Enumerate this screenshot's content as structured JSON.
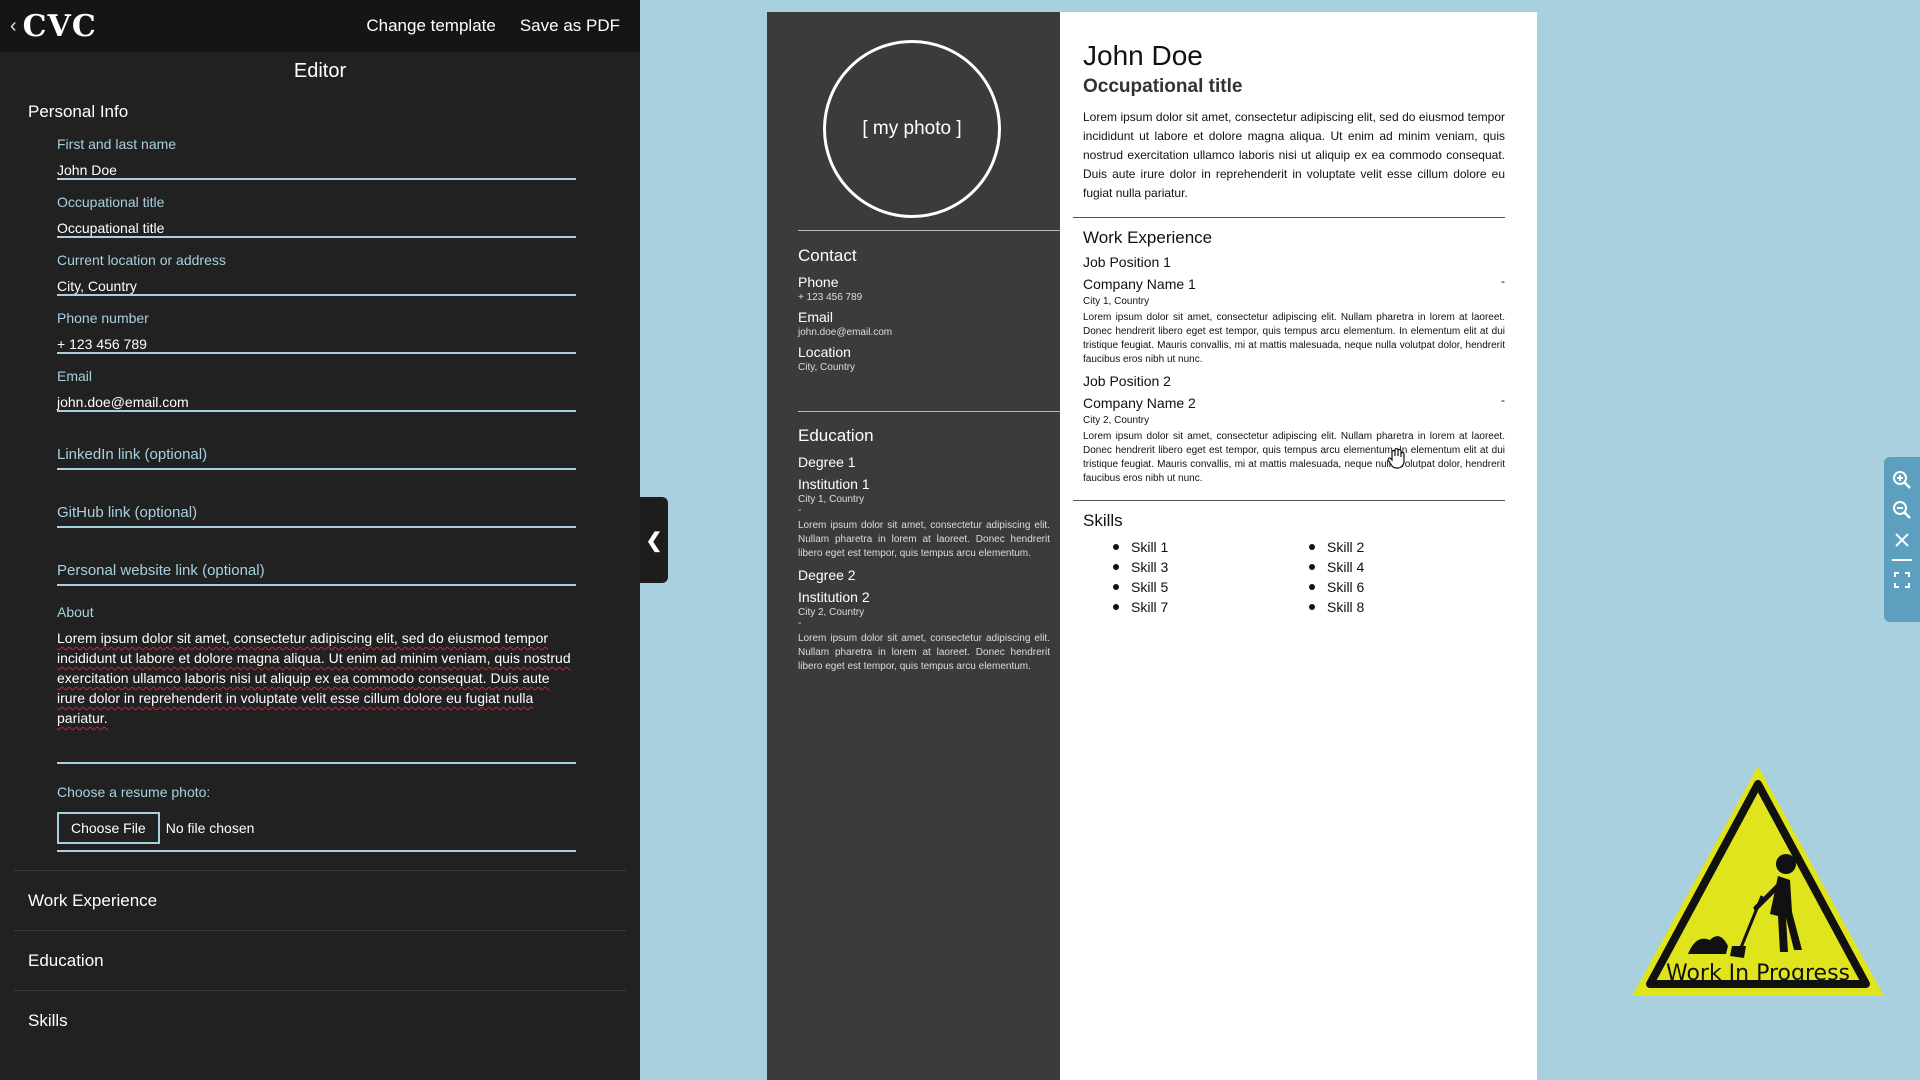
{
  "app": {
    "logo": "CVC",
    "back_icon": "chevron-left-icon",
    "change_template": "Change template",
    "save_pdf": "Save as PDF"
  },
  "editor": {
    "title": "Editor",
    "personal_info": "Personal Info",
    "fields": {
      "name_label": "First and last name",
      "name_value": "John Doe",
      "occ_label": "Occupational title",
      "occ_value": "Occupational title",
      "location_label": "Current location or address",
      "location_value": "City, Country",
      "phone_label": "Phone number",
      "phone_value": "+ 123 456 789",
      "email_label": "Email",
      "email_value": "john.doe@email.com",
      "linkedin_placeholder": "LinkedIn link (optional)",
      "github_placeholder": "GitHub link (optional)",
      "website_placeholder": "Personal website link (optional)",
      "about_label": "About",
      "about_value": "Lorem ipsum dolor sit amet, consectetur adipiscing elit, sed do eiusmod tempor incididunt ut labore et dolore magna aliqua. Ut enim ad minim veniam, quis nostrud exercitation ullamco laboris nisi ut aliquip ex ea commodo consequat. Duis aute irure dolor in reprehenderit in voluptate velit esse cillum dolore eu fugiat nulla pariatur.",
      "photo_label": "Choose a resume photo:",
      "file_button": "Choose File",
      "file_status": "No file chosen"
    },
    "sections": [
      "Work Experience",
      "Education",
      "Skills"
    ]
  },
  "resume": {
    "photo_placeholder": "[ my photo ]",
    "contact": {
      "heading": "Contact",
      "phone_label": "Phone",
      "phone": "+ 123 456 789",
      "email_label": "Email",
      "email": "john.doe@email.com",
      "location_label": "Location",
      "location": "City, Country"
    },
    "education": {
      "heading": "Education",
      "items": [
        {
          "degree": "Degree 1",
          "institution": "Institution 1",
          "city": "City 1, Country",
          "dash": "-",
          "desc": "Lorem ipsum dolor sit amet, consectetur adipiscing elit. Nullam pharetra in lorem at laoreet. Donec hendrerit libero eget est tempor, quis tempus arcu elementum."
        },
        {
          "degree": "Degree 2",
          "institution": "Institution 2",
          "city": "City 2, Country",
          "dash": "-",
          "desc": "Lorem ipsum dolor sit amet, consectetur adipiscing elit. Nullam pharetra in lorem at laoreet. Donec hendrerit libero eget est tempor, quis tempus arcu elementum."
        }
      ]
    },
    "name": "John Doe",
    "occupation": "Occupational title",
    "about": "Lorem ipsum dolor sit amet, consectetur adipiscing elit, sed do eiusmod tempor incididunt ut labore et dolore magna aliqua. Ut enim ad minim veniam, quis nostrud exercitation ullamco laboris nisi ut aliquip ex ea commodo consequat. Duis aute irure dolor in reprehenderit in voluptate velit esse cillum dolore eu fugiat nulla pariatur.",
    "work": {
      "heading": "Work Experience",
      "items": [
        {
          "title": "Job Position 1",
          "company": "Company Name 1",
          "dash": "-",
          "city": "City 1, Country",
          "desc": "Lorem ipsum dolor sit amet, consectetur adipiscing elit. Nullam pharetra in lorem at laoreet. Donec hendrerit libero eget est tempor, quis tempus arcu elementum. In elementum elit at dui tristique feugiat. Mauris convallis, mi at mattis malesuada, neque nulla volutpat dolor, hendrerit faucibus eros nibh ut nunc."
        },
        {
          "title": "Job Position 2",
          "company": "Company Name 2",
          "dash": "-",
          "city": "City 2, Country",
          "desc": "Lorem ipsum dolor sit amet, consectetur adipiscing elit. Nullam pharetra in lorem at laoreet. Donec hendrerit libero eget est tempor, quis tempus arcu elementum. In elementum elit at dui tristique feugiat. Mauris convallis, mi at mattis malesuada, neque nulla volutpat dolor, hendrerit faucibus eros nibh ut nunc."
        }
      ]
    },
    "skills": {
      "heading": "Skills",
      "items": [
        "Skill 1",
        "Skill 2",
        "Skill 3",
        "Skill 4",
        "Skill 5",
        "Skill 6",
        "Skill 7",
        "Skill 8"
      ]
    }
  },
  "toolbar": {
    "icons": [
      "zoom-in-icon",
      "zoom-out-icon",
      "close-icon",
      "fullscreen-icon"
    ]
  },
  "badge": {
    "text": "Work In Progress"
  },
  "colors": {
    "editor_bg": "#212121",
    "accent": "#a9d0df",
    "sidebar_bg": "#3b3b3b",
    "warning_yellow": "#e0e41c"
  }
}
